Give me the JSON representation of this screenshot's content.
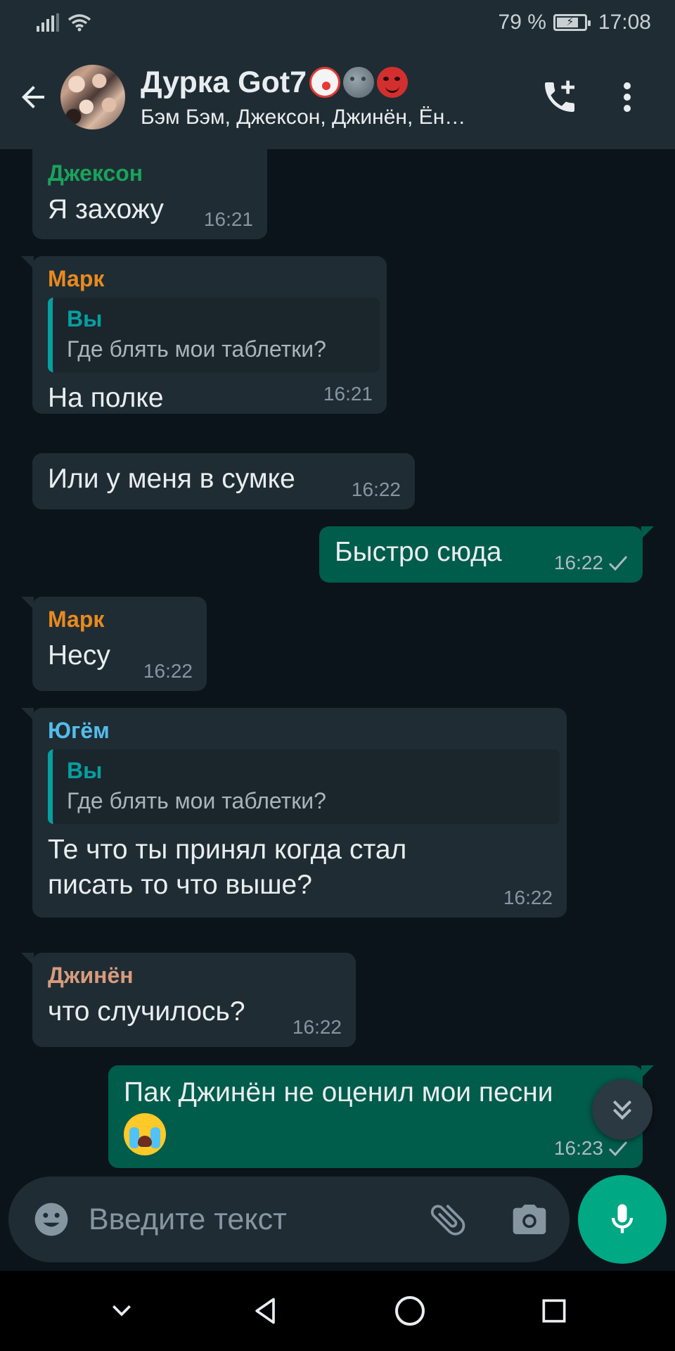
{
  "status_bar": {
    "battery": "79 %",
    "time": "17:08"
  },
  "header": {
    "title": "Дурка Got7",
    "subtitle": "Бэм Бэм, Джексон, Джинён, Ён…",
    "emoji": [
      "clown-face",
      "new-moon-face",
      "smiling-devil"
    ]
  },
  "messages": [
    {
      "direction": "in",
      "sender": "Джексон",
      "sender_color": "#19a35b",
      "text": "Я захожу",
      "time": "16:21"
    },
    {
      "direction": "in",
      "sender": "Марк",
      "sender_color": "#e98a1e",
      "quote": {
        "author": "Вы",
        "text": "Где блять мои таблетки?"
      },
      "text": "На полке",
      "time": "16:21"
    },
    {
      "direction": "in",
      "text": "Или у меня в сумке",
      "time": "16:22"
    },
    {
      "direction": "out",
      "text": "Быстро сюда",
      "time": "16:22",
      "status": "sent"
    },
    {
      "direction": "in",
      "sender": "Марк",
      "sender_color": "#e98a1e",
      "text": "Несу",
      "time": "16:22"
    },
    {
      "direction": "in",
      "sender": "Югём",
      "sender_color": "#53bdeb",
      "quote": {
        "author": "Вы",
        "text": "Где блять мои таблетки?"
      },
      "text_lines": [
        "Те что ты принял когда стал",
        "писать то что выше?"
      ],
      "time": "16:22"
    },
    {
      "direction": "in",
      "sender": "Джинён",
      "sender_color": "#d79b7d",
      "text": "что случилось?",
      "time": "16:22"
    },
    {
      "direction": "out",
      "text": "Пак Джинён не оценил мои песни",
      "emoji": "loudly-crying-face",
      "time": "16:23",
      "status": "sent"
    }
  ],
  "composer": {
    "placeholder": "Введите текст"
  },
  "icons": {
    "back": "arrow-back-icon",
    "call": "add-call-icon",
    "menu": "more-vert-icon",
    "emoji": "emoji-icon",
    "attach": "paperclip-icon",
    "camera": "camera-icon",
    "mic": "mic-icon",
    "scroll": "double-chevron-down-icon"
  },
  "colors": {
    "accent": "#00a884",
    "incoming_bubble": "#1f2c34",
    "outgoing_bubble": "#005c4b",
    "quote_accent": "#06a0a0"
  }
}
